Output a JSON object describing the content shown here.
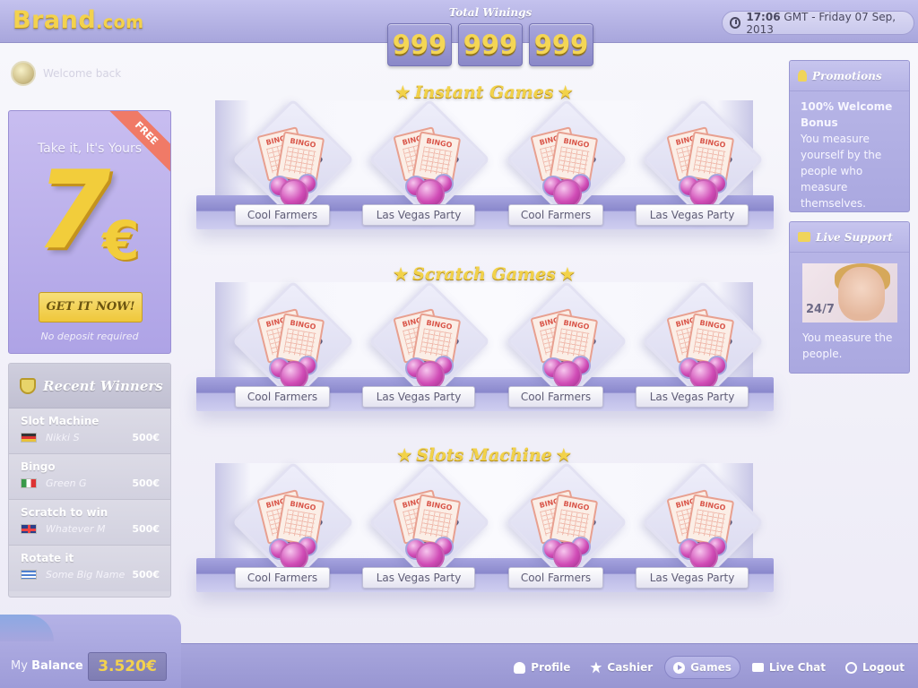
{
  "header": {
    "brand": "Brand",
    "brand_suffix": ".com",
    "total_winnings_label": "Total Winings",
    "counter": [
      "999",
      "999",
      "999"
    ],
    "clock_time": "17:06",
    "clock_rest": "GMT - Friday 07 Sep, 2013"
  },
  "welcome": {
    "text": "Welcome back"
  },
  "promo": {
    "ribbon": "FREE",
    "title": "Take it, It's Yours",
    "amount": "7",
    "currency": "€",
    "cta": "GET IT NOW!",
    "note": "No deposit required"
  },
  "winners": {
    "title": "Recent Winners",
    "rows": [
      {
        "game": "Slot Machine",
        "name": "Nikki S",
        "amount": "500€",
        "flag": "de"
      },
      {
        "game": "Bingo",
        "name": "Green G",
        "amount": "500€",
        "flag": "it"
      },
      {
        "game": "Scratch to win",
        "name": "Whatever M",
        "amount": "500€",
        "flag": "uk"
      },
      {
        "game": "Rotate it",
        "name": "Some Big Name",
        "amount": "500€",
        "flag": "gr"
      }
    ]
  },
  "sections": [
    {
      "title": "Instant Games",
      "games": [
        "Cool Farmers",
        "Las Vegas Party",
        "Cool Farmers",
        "Las Vegas Party"
      ]
    },
    {
      "title": "Scratch Games",
      "games": [
        "Cool Farmers",
        "Las Vegas Party",
        "Cool Farmers",
        "Las Vegas Party"
      ]
    },
    {
      "title": "Slots Machine",
      "games": [
        "Cool Farmers",
        "Las Vegas Party",
        "Cool Farmers",
        "Las Vegas Party"
      ]
    }
  ],
  "tile_card_label": "BINGO",
  "promotions": {
    "title": "Promotions",
    "heading": "100% Welcome Bonus",
    "body": "You measure yourself by the people who measure themselves."
  },
  "support": {
    "title": "Live Support",
    "badge": "24/7",
    "body": "You measure the people."
  },
  "footer": {
    "balance_prefix": "My",
    "balance_label": "Balance",
    "balance_value": "3.520€",
    "nav": [
      {
        "label": "Profile",
        "icon": "profile-icon"
      },
      {
        "label": "Cashier",
        "icon": "star-icon"
      },
      {
        "label": "Games",
        "icon": "play-icon",
        "active": true
      },
      {
        "label": "Live Chat",
        "icon": "chat-icon"
      },
      {
        "label": "Logout",
        "icon": "power-icon"
      }
    ]
  },
  "colors": {
    "accent_gold": "#f2d24a",
    "bar_purple": "#a8a6dc",
    "ribbon_red": "#f07a67"
  }
}
